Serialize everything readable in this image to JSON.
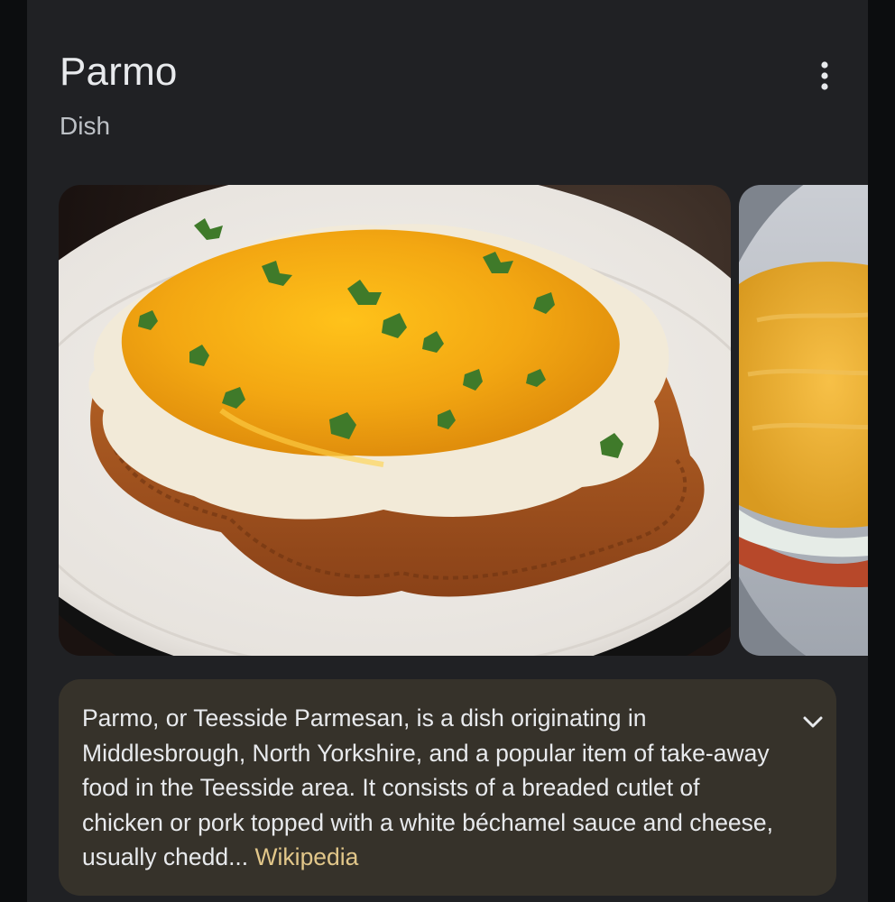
{
  "entity": {
    "title": "Parmo",
    "subtitle": "Dish"
  },
  "menu": {
    "icon": "more-vert-icon"
  },
  "gallery": {
    "images": [
      {
        "alt": "Parmo"
      },
      {
        "alt": "Parmo"
      }
    ]
  },
  "description": {
    "text": "Parmo, or Teesside Parmesan, is a dish originating in Middlesbrough, North Yorkshire, and a popular item of take-away food in the Teesside area. It consists of a breaded cutlet of chicken or pork topped with a white béchamel sauce and cheese, usually chedd",
    "ellipsis": "...",
    "source_label": "Wikipedia",
    "expand_icon": "chevron-down-icon"
  },
  "colors": {
    "card_background": "#202124",
    "description_background": "#36322a",
    "source_link": "#e2c78a",
    "text_primary": "#e8eaed",
    "text_secondary": "#bdc1c6"
  }
}
